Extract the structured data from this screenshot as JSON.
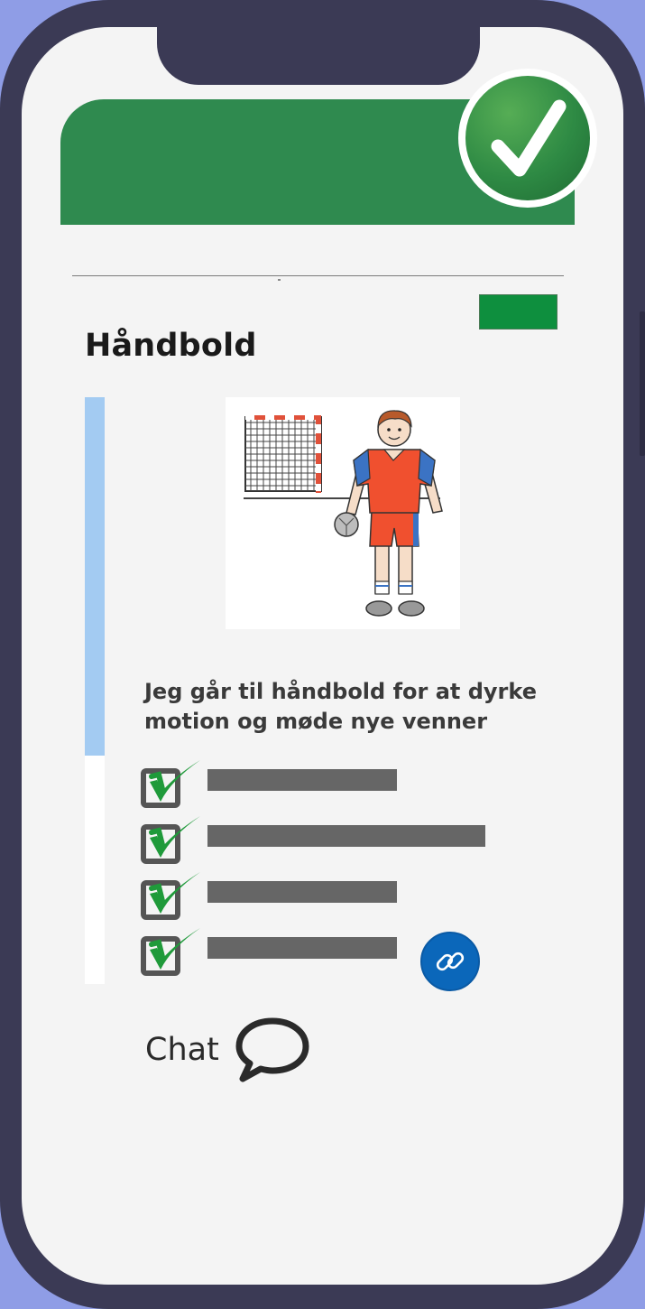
{
  "app": {
    "title": "Håndbold",
    "description": "Jeg går til håndbold for at dyrke motion og møde nye venner"
  },
  "header": {
    "status_icon": "checkmark-badge-icon",
    "accent_color": "#2f8a4f"
  },
  "status_chip": {
    "color": "#0e8f3e"
  },
  "progress": {
    "fraction": 0.61,
    "color": "#a3cbf2"
  },
  "picture": {
    "icon": "handball-player-pictogram",
    "alt": ""
  },
  "tasks": [
    {
      "checked": true,
      "bar_fraction": 0.49,
      "has_link": false
    },
    {
      "checked": true,
      "bar_fraction": 0.72,
      "has_link": false
    },
    {
      "checked": true,
      "bar_fraction": 0.49,
      "has_link": false
    },
    {
      "checked": true,
      "bar_fraction": 0.49,
      "has_link": true
    }
  ],
  "link": {
    "icon": "link-icon",
    "color": "#0b67ba"
  },
  "chat": {
    "label": "Chat",
    "icon": "speech-bubble-icon"
  }
}
